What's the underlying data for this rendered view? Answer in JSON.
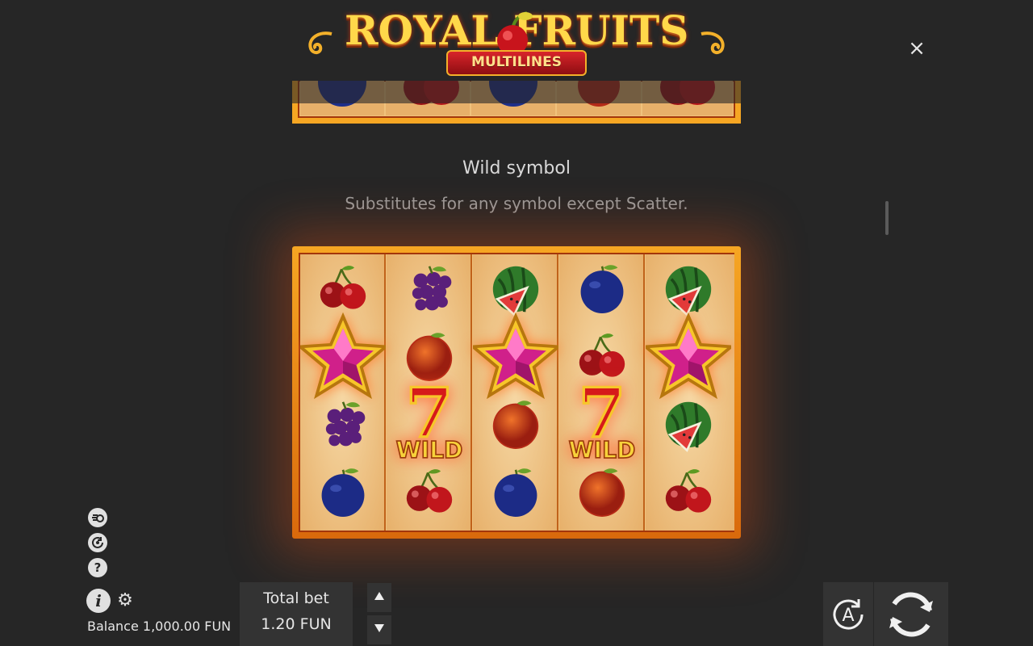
{
  "logo": {
    "title": "ROYAL FRUITS",
    "subtitle": "MULTILINES"
  },
  "close_label": "×",
  "symbol": {
    "title": "Wild symbol",
    "description": "Substitutes for any symbol except Scatter."
  },
  "reel": {
    "columns": [
      [
        "cherry",
        "star",
        "grape",
        "plum"
      ],
      [
        "grape",
        "orange",
        "wild",
        "cherry"
      ],
      [
        "watermelon",
        "star",
        "orange",
        "plum"
      ],
      [
        "plum",
        "cherry",
        "wild",
        "orange"
      ],
      [
        "watermelon",
        "star",
        "watermelon",
        "cherry"
      ]
    ],
    "wild_label": "WILD"
  },
  "side_icons": [
    "turbo-icon",
    "history-icon",
    "help-icon"
  ],
  "info_label": "i",
  "help_label": "?",
  "balance": {
    "label": "Balance",
    "value": "1,000.00",
    "currency": "FUN",
    "text": "Balance 1,000.00 FUN"
  },
  "bet": {
    "label": "Total bet",
    "value": "1.20 FUN"
  },
  "auto_label": "A",
  "colors": {
    "frame": "#f6a623",
    "accent": "#e2d237"
  }
}
